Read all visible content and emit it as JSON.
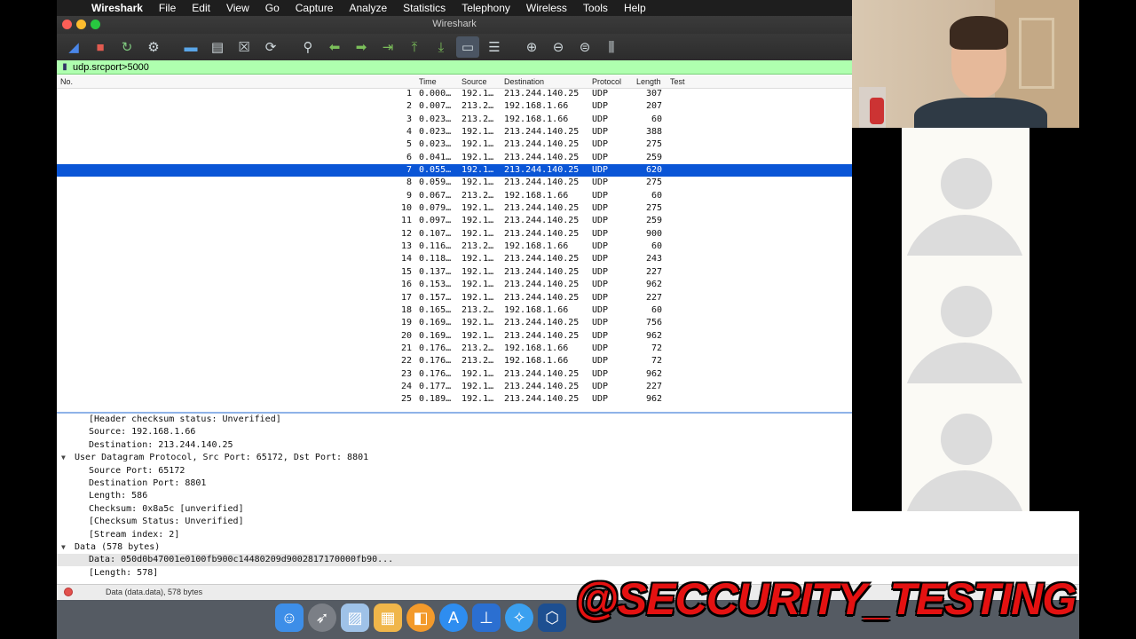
{
  "menubar": {
    "app_name": "Wireshark",
    "items": [
      "File",
      "Edit",
      "View",
      "Go",
      "Capture",
      "Analyze",
      "Statistics",
      "Telephony",
      "Wireless",
      "Tools",
      "Help"
    ]
  },
  "window": {
    "title": "Wireshark"
  },
  "toolbar": {
    "icons": [
      "shark-fin-start-icon",
      "stop-capture-icon",
      "restart-capture-icon",
      "capture-options-icon",
      "open-file-icon",
      "save-file-icon",
      "close-file-icon",
      "reload-file-icon",
      "find-packet-icon",
      "go-back-icon",
      "go-forward-icon",
      "go-to-packet-icon",
      "go-first-icon",
      "go-last-icon",
      "autoscroll-icon",
      "colorize-icon",
      "zoom-in-icon",
      "zoom-out-icon",
      "zoom-normal-icon",
      "resize-columns-icon"
    ]
  },
  "filter": {
    "value": "udp.srcport>5000"
  },
  "packet_list": {
    "columns": [
      "No.",
      "Time",
      "Source",
      "Destination",
      "Protocol",
      "Length",
      "Test"
    ],
    "selected_index": 6,
    "rows": [
      {
        "no": "1",
        "time": "0.000…",
        "src": "192.1…",
        "dst": "213.244.140.25",
        "proto": "UDP",
        "len": "307"
      },
      {
        "no": "2",
        "time": "0.007…",
        "src": "213.2…",
        "dst": "192.168.1.66",
        "proto": "UDP",
        "len": "207"
      },
      {
        "no": "3",
        "time": "0.023…",
        "src": "213.2…",
        "dst": "192.168.1.66",
        "proto": "UDP",
        "len": "60"
      },
      {
        "no": "4",
        "time": "0.023…",
        "src": "192.1…",
        "dst": "213.244.140.25",
        "proto": "UDP",
        "len": "388"
      },
      {
        "no": "5",
        "time": "0.023…",
        "src": "192.1…",
        "dst": "213.244.140.25",
        "proto": "UDP",
        "len": "275"
      },
      {
        "no": "6",
        "time": "0.041…",
        "src": "192.1…",
        "dst": "213.244.140.25",
        "proto": "UDP",
        "len": "259"
      },
      {
        "no": "7",
        "time": "0.055…",
        "src": "192.1…",
        "dst": "213.244.140.25",
        "proto": "UDP",
        "len": "620"
      },
      {
        "no": "8",
        "time": "0.059…",
        "src": "192.1…",
        "dst": "213.244.140.25",
        "proto": "UDP",
        "len": "275"
      },
      {
        "no": "9",
        "time": "0.067…",
        "src": "213.2…",
        "dst": "192.168.1.66",
        "proto": "UDP",
        "len": "60"
      },
      {
        "no": "10",
        "time": "0.079…",
        "src": "192.1…",
        "dst": "213.244.140.25",
        "proto": "UDP",
        "len": "275"
      },
      {
        "no": "11",
        "time": "0.097…",
        "src": "192.1…",
        "dst": "213.244.140.25",
        "proto": "UDP",
        "len": "259"
      },
      {
        "no": "12",
        "time": "0.107…",
        "src": "192.1…",
        "dst": "213.244.140.25",
        "proto": "UDP",
        "len": "900"
      },
      {
        "no": "13",
        "time": "0.116…",
        "src": "213.2…",
        "dst": "192.168.1.66",
        "proto": "UDP",
        "len": "60"
      },
      {
        "no": "14",
        "time": "0.118…",
        "src": "192.1…",
        "dst": "213.244.140.25",
        "proto": "UDP",
        "len": "243"
      },
      {
        "no": "15",
        "time": "0.137…",
        "src": "192.1…",
        "dst": "213.244.140.25",
        "proto": "UDP",
        "len": "227"
      },
      {
        "no": "16",
        "time": "0.153…",
        "src": "192.1…",
        "dst": "213.244.140.25",
        "proto": "UDP",
        "len": "962"
      },
      {
        "no": "17",
        "time": "0.157…",
        "src": "192.1…",
        "dst": "213.244.140.25",
        "proto": "UDP",
        "len": "227"
      },
      {
        "no": "18",
        "time": "0.165…",
        "src": "213.2…",
        "dst": "192.168.1.66",
        "proto": "UDP",
        "len": "60"
      },
      {
        "no": "19",
        "time": "0.169…",
        "src": "192.1…",
        "dst": "213.244.140.25",
        "proto": "UDP",
        "len": "756"
      },
      {
        "no": "20",
        "time": "0.169…",
        "src": "192.1…",
        "dst": "213.244.140.25",
        "proto": "UDP",
        "len": "962"
      },
      {
        "no": "21",
        "time": "0.176…",
        "src": "213.2…",
        "dst": "192.168.1.66",
        "proto": "UDP",
        "len": "72"
      },
      {
        "no": "22",
        "time": "0.176…",
        "src": "213.2…",
        "dst": "192.168.1.66",
        "proto": "UDP",
        "len": "72"
      },
      {
        "no": "23",
        "time": "0.176…",
        "src": "192.1…",
        "dst": "213.244.140.25",
        "proto": "UDP",
        "len": "962"
      },
      {
        "no": "24",
        "time": "0.177…",
        "src": "192.1…",
        "dst": "213.244.140.25",
        "proto": "UDP",
        "len": "227"
      },
      {
        "no": "25",
        "time": "0.189…",
        "src": "192.1…",
        "dst": "213.244.140.25",
        "proto": "UDP",
        "len": "962"
      }
    ]
  },
  "details": {
    "lines": [
      {
        "text": "[Header checksum status: Unverified]",
        "indent": 2,
        "expander": ""
      },
      {
        "text": "Source: 192.168.1.66",
        "indent": 2,
        "expander": ""
      },
      {
        "text": "Destination: 213.244.140.25",
        "indent": 2,
        "expander": ""
      },
      {
        "text": "User Datagram Protocol, Src Port: 65172, Dst Port: 8801",
        "indent": 1,
        "expander": "▼"
      },
      {
        "text": "Source Port: 65172",
        "indent": 2,
        "expander": ""
      },
      {
        "text": "Destination Port: 8801",
        "indent": 2,
        "expander": ""
      },
      {
        "text": "Length: 586",
        "indent": 2,
        "expander": ""
      },
      {
        "text": "Checksum: 0x8a5c [unverified]",
        "indent": 2,
        "expander": ""
      },
      {
        "text": "[Checksum Status: Unverified]",
        "indent": 2,
        "expander": ""
      },
      {
        "text": "[Stream index: 2]",
        "indent": 2,
        "expander": ""
      },
      {
        "text": "Data (578 bytes)",
        "indent": 1,
        "expander": "▼"
      },
      {
        "text": "Data: 050d0b47001e0100fb900c14480209d9002817170000fb90...",
        "indent": 2,
        "expander": "",
        "highlight": true
      },
      {
        "text": "[Length: 578]",
        "indent": 2,
        "expander": ""
      }
    ]
  },
  "statusbar": {
    "text": "Data (data.data), 578 bytes"
  },
  "dock": {
    "icons": [
      "finder-icon",
      "launchpad-icon",
      "preview-icon",
      "photos-icon",
      "books-icon",
      "app-store-icon",
      "keynote-icon",
      "safari-icon",
      "virtualbox-icon"
    ]
  },
  "watermark": {
    "text": "@SECCURITY_TESTING"
  },
  "colors": {
    "selection": "#0a55d6",
    "filter_valid": "#afffaf",
    "watermark": "#e41111"
  }
}
